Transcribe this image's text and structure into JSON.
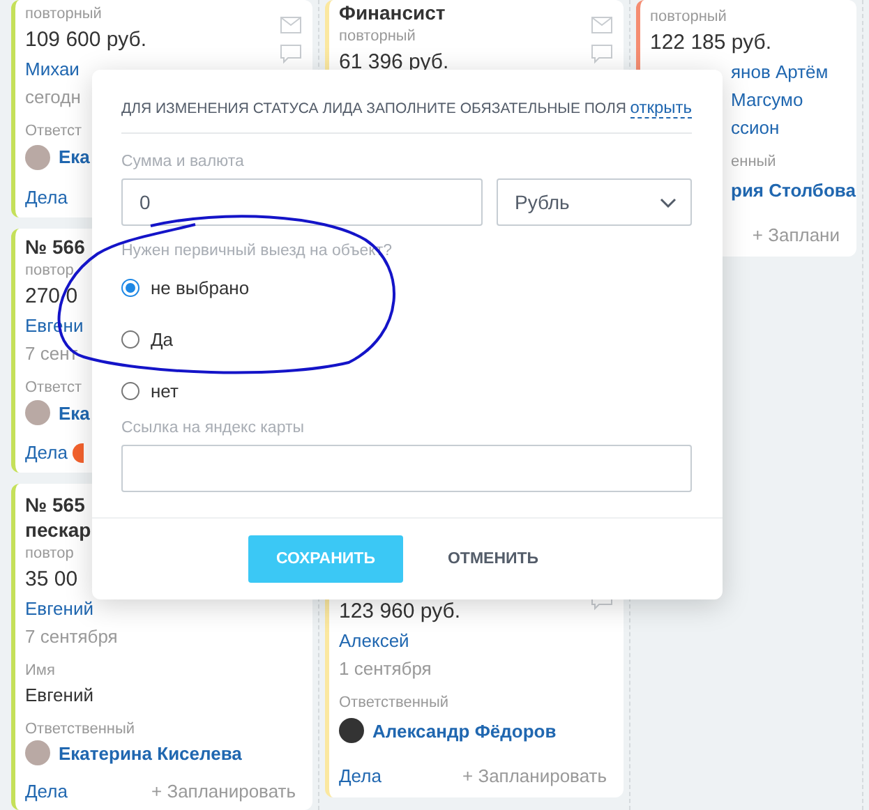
{
  "columns": [
    {
      "color": "#c5e05a",
      "cards": [
        {
          "lines": [
            {
              "kind": "tag",
              "text": "повторный"
            },
            {
              "kind": "amount",
              "text": "109 600 руб."
            },
            {
              "kind": "contact",
              "text": "Михаи"
            },
            {
              "kind": "date",
              "text": "сегодн"
            },
            {
              "kind": "label",
              "text": "Ответст"
            },
            {
              "kind": "person",
              "text": "Ека"
            },
            {
              "kind": "footer",
              "deals": "Дела"
            }
          ]
        },
        {
          "lines": [
            {
              "kind": "title",
              "text": "№ 566"
            },
            {
              "kind": "tag",
              "text": "повтор"
            },
            {
              "kind": "amount",
              "text": "270 0"
            },
            {
              "kind": "contact",
              "text": "Евгени"
            },
            {
              "kind": "date",
              "text": "7 сент"
            },
            {
              "kind": "label",
              "text": "Ответст"
            },
            {
              "kind": "person",
              "text": "Ека"
            },
            {
              "kind": "footer",
              "deals": "Дела",
              "badge": true
            }
          ]
        },
        {
          "lines": [
            {
              "kind": "title",
              "text": "№ 565"
            },
            {
              "kind": "title",
              "text": "пескар"
            },
            {
              "kind": "tag",
              "text": "повтор"
            },
            {
              "kind": "amount",
              "text": "35 00"
            },
            {
              "kind": "contact",
              "text": "Евгений"
            },
            {
              "kind": "date",
              "text": "7 сентября"
            },
            {
              "kind": "label",
              "text": "Имя"
            },
            {
              "kind": "value",
              "text": "Евгений"
            },
            {
              "kind": "label",
              "text": "Ответственный"
            },
            {
              "kind": "person",
              "text": "Екатерина Киселева"
            },
            {
              "kind": "footer",
              "deals": "Дела",
              "plan": "+ Запланировать"
            }
          ]
        }
      ]
    },
    {
      "color": "#fbe8a0",
      "cards": [
        {
          "lines": [
            {
              "kind": "title",
              "text": "Финансист"
            },
            {
              "kind": "tag",
              "text": "повторный"
            },
            {
              "kind": "amount",
              "text": "61 396 руб."
            }
          ]
        },
        {
          "lines": [
            {
              "kind": "amount",
              "text": "123 960 руб."
            },
            {
              "kind": "contact",
              "text": "Алексей"
            },
            {
              "kind": "date",
              "text": "1 сентября"
            },
            {
              "kind": "label",
              "text": "Ответственный"
            },
            {
              "kind": "person",
              "text": "Александр Фёдоров"
            },
            {
              "kind": "footer",
              "deals": "Дела",
              "plan": "+ Запланировать"
            }
          ]
        }
      ]
    },
    {
      "color": "#f58d72",
      "cards": [
        {
          "lines": [
            {
              "kind": "tag",
              "text": "повторный"
            },
            {
              "kind": "amount",
              "text": "122 185 руб."
            },
            {
              "kind": "contact",
              "text": "янов Артём Магсумо"
            },
            {
              "kind": "contact",
              "text": "ссион"
            },
            {
              "kind": "label",
              "text": "енный"
            },
            {
              "kind": "name",
              "text": "рия Столбова"
            },
            {
              "kind": "footer",
              "plan": "+ Заплани"
            }
          ]
        }
      ]
    }
  ],
  "modal": {
    "heading": "ДЛЯ ИЗМЕНЕНИЯ СТАТУСА ЛИДА ЗАПОЛНИТЕ ОБЯЗАТЕЛЬНЫЕ ПОЛЯ",
    "open_link": "открыть",
    "amount_label": "Сумма и валюта",
    "amount_value": "0",
    "currency": "Рубль",
    "question": "Нужен первичный выезд на объект?",
    "options": [
      {
        "label": "не выбрано",
        "selected": true
      },
      {
        "label": "Да",
        "selected": false
      },
      {
        "label": "нет",
        "selected": false
      }
    ],
    "map_label": "Ссылка на яндекс карты",
    "buttons": [
      {
        "kind": "primary",
        "label": "СОХРАНИТЬ"
      },
      {
        "kind": "plain",
        "label": "ОТМЕНИТЬ"
      }
    ]
  }
}
